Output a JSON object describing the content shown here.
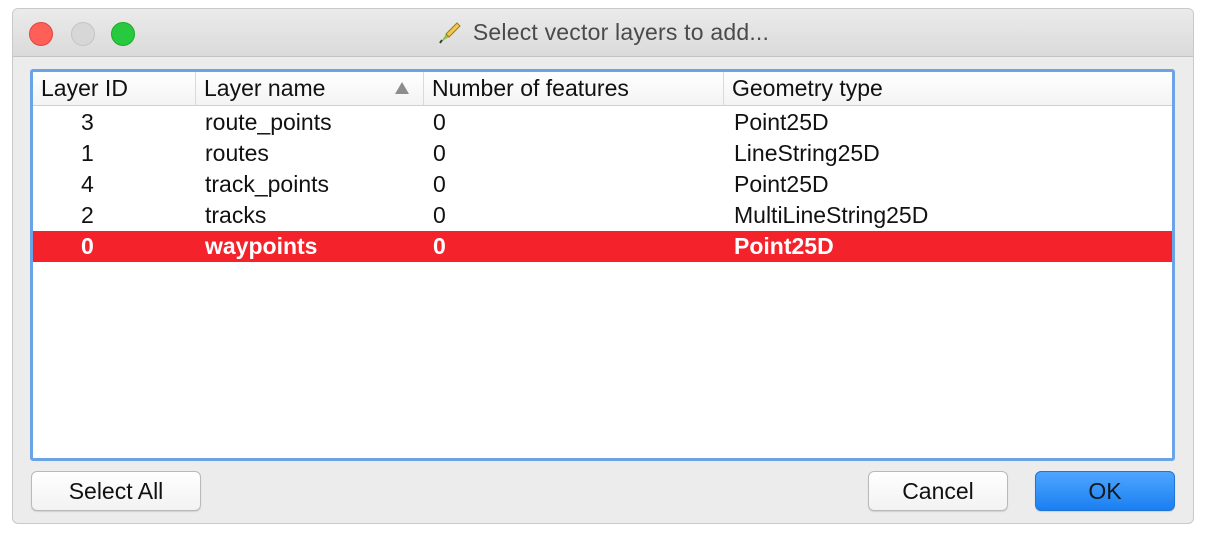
{
  "window": {
    "title": "Select vector layers to add...",
    "app_icon": "qgis-pencil-icon"
  },
  "table": {
    "columns": [
      "Layer ID",
      "Layer name",
      "Number of features",
      "Geometry type"
    ],
    "sorted_column": "Layer name",
    "sort_direction": "ascending",
    "rows": [
      {
        "id": "3",
        "name": "route_points",
        "features": "0",
        "geometry": "Point25D",
        "selected": false
      },
      {
        "id": "1",
        "name": "routes",
        "features": "0",
        "geometry": "LineString25D",
        "selected": false
      },
      {
        "id": "4",
        "name": "track_points",
        "features": "0",
        "geometry": "Point25D",
        "selected": false
      },
      {
        "id": "2",
        "name": "tracks",
        "features": "0",
        "geometry": "MultiLineString25D",
        "selected": false
      },
      {
        "id": "0",
        "name": "waypoints",
        "features": "0",
        "geometry": "Point25D",
        "selected": true
      }
    ]
  },
  "buttons": {
    "select_all": "Select All",
    "cancel": "Cancel",
    "ok": "OK"
  },
  "colors": {
    "selection": "#f3222b",
    "focus_ring": "#6aa4e6",
    "ok_button": "#1a7ff2"
  }
}
